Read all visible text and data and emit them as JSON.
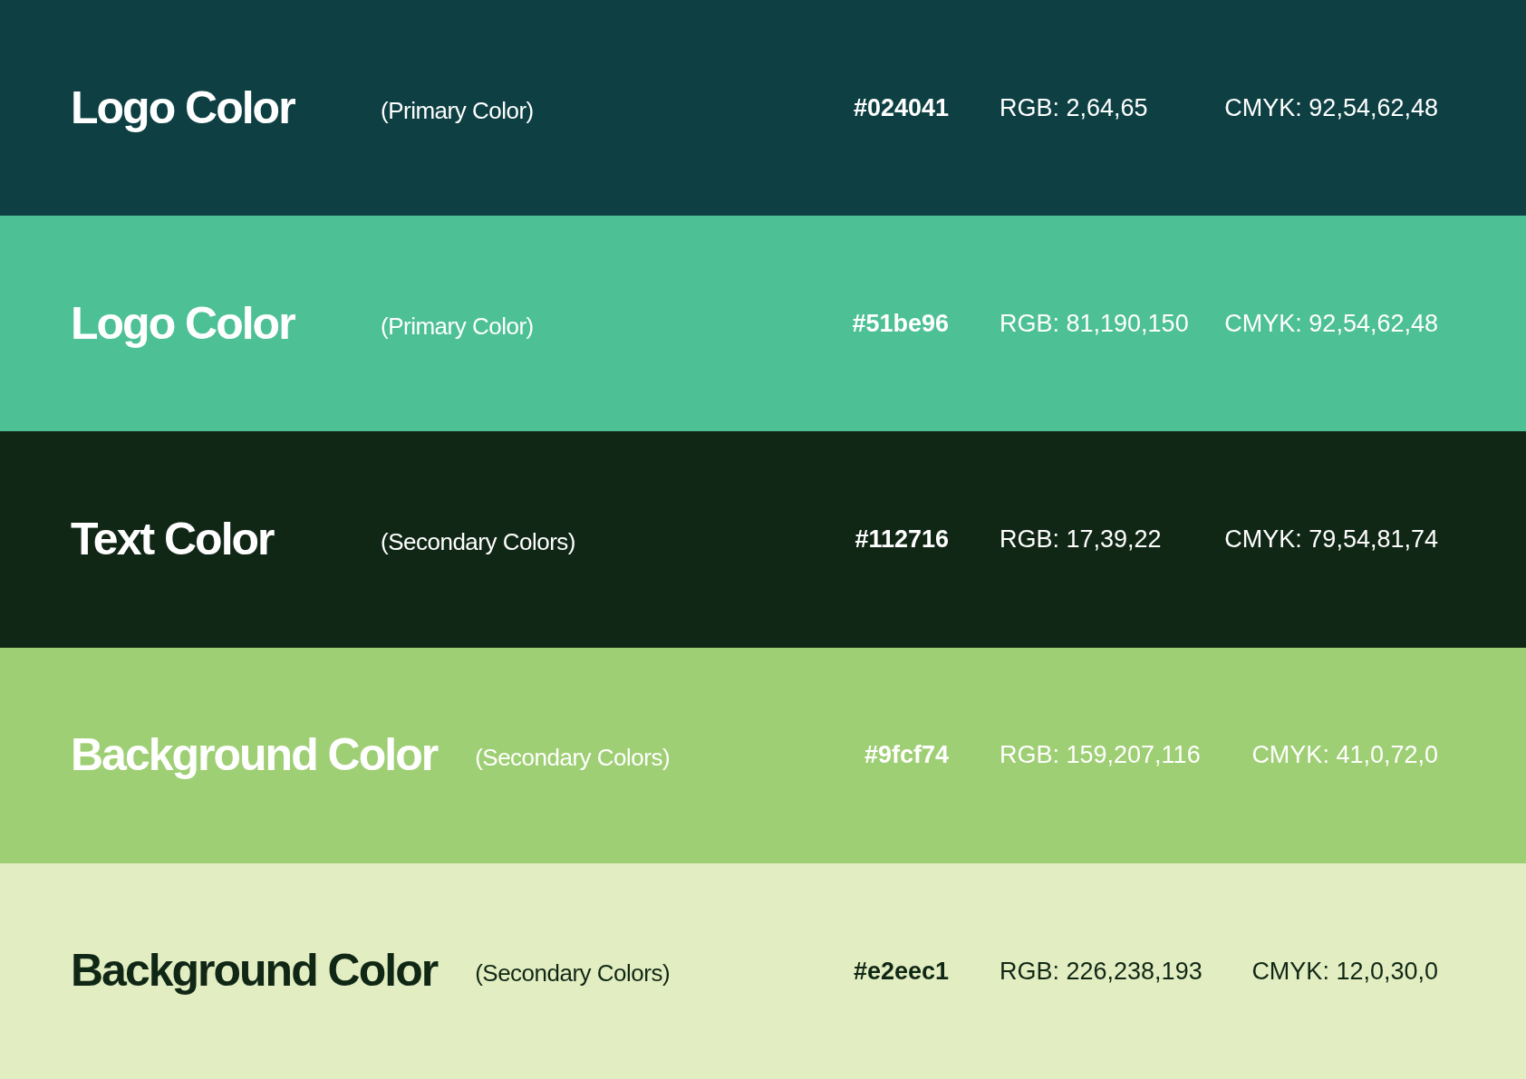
{
  "swatches": [
    {
      "title": "Logo Color",
      "subtitle": "(Primary Color)",
      "hex": "#024041",
      "rgb": "RGB: 2,64,65",
      "cmyk": "CMYK: 92,54,62,48",
      "color": "#0e4043",
      "kind": "light"
    },
    {
      "title": "Logo Color",
      "subtitle": "(Primary Color)",
      "hex": "#51be96",
      "rgb": "RGB: 81,190,150",
      "cmyk": "CMYK: 92,54,62,48",
      "color": "#4dc096",
      "kind": "light"
    },
    {
      "title": "Text Color",
      "subtitle": "(Secondary Colors)",
      "hex": "#112716",
      "rgb": "RGB: 17,39,22",
      "cmyk": "CMYK: 79,54,81,74",
      "color": "#112716",
      "kind": "light"
    },
    {
      "title": "Background Color",
      "subtitle": "(Secondary Colors)",
      "hex": "#9fcf74",
      "rgb": "RGB: 159,207,116",
      "cmyk": "CMYK: 41,0,72,0",
      "color": "#9fcf74",
      "kind": "light"
    },
    {
      "title": "Background Color",
      "subtitle": "(Secondary Colors)",
      "hex": "#e2eec1",
      "rgb": "RGB: 226,238,193",
      "cmyk": "CMYK: 12,0,30,0",
      "color": "#e2eec1",
      "kind": "dark"
    }
  ]
}
